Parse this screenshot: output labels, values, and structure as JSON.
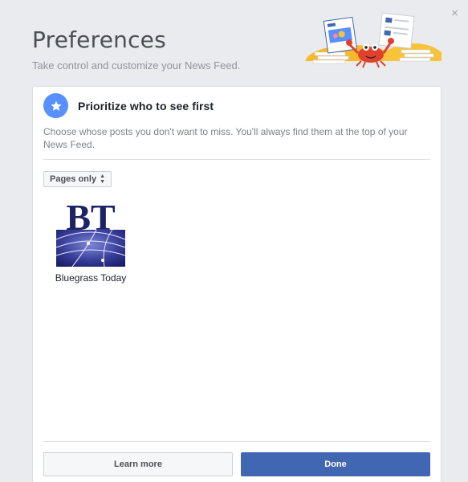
{
  "dialog": {
    "close_glyph": "×"
  },
  "header": {
    "title": "Preferences",
    "subtitle": "Take control and customize your News Feed."
  },
  "section": {
    "icon": "star-icon",
    "title": "Prioritize who to see first",
    "description": "Choose whose posts you don't want to miss. You'll always find them at the top of your News Feed."
  },
  "filter": {
    "selected": "Pages only"
  },
  "pages": [
    {
      "name": "Bluegrass Today",
      "logo_text": "BT"
    }
  ],
  "footer": {
    "learn_more_label": "Learn more",
    "done_label": "Done"
  },
  "colors": {
    "background": "#e9ebee",
    "accent": "#4267b2",
    "star_circle": "#5890ff",
    "crab": "#e0412f"
  }
}
